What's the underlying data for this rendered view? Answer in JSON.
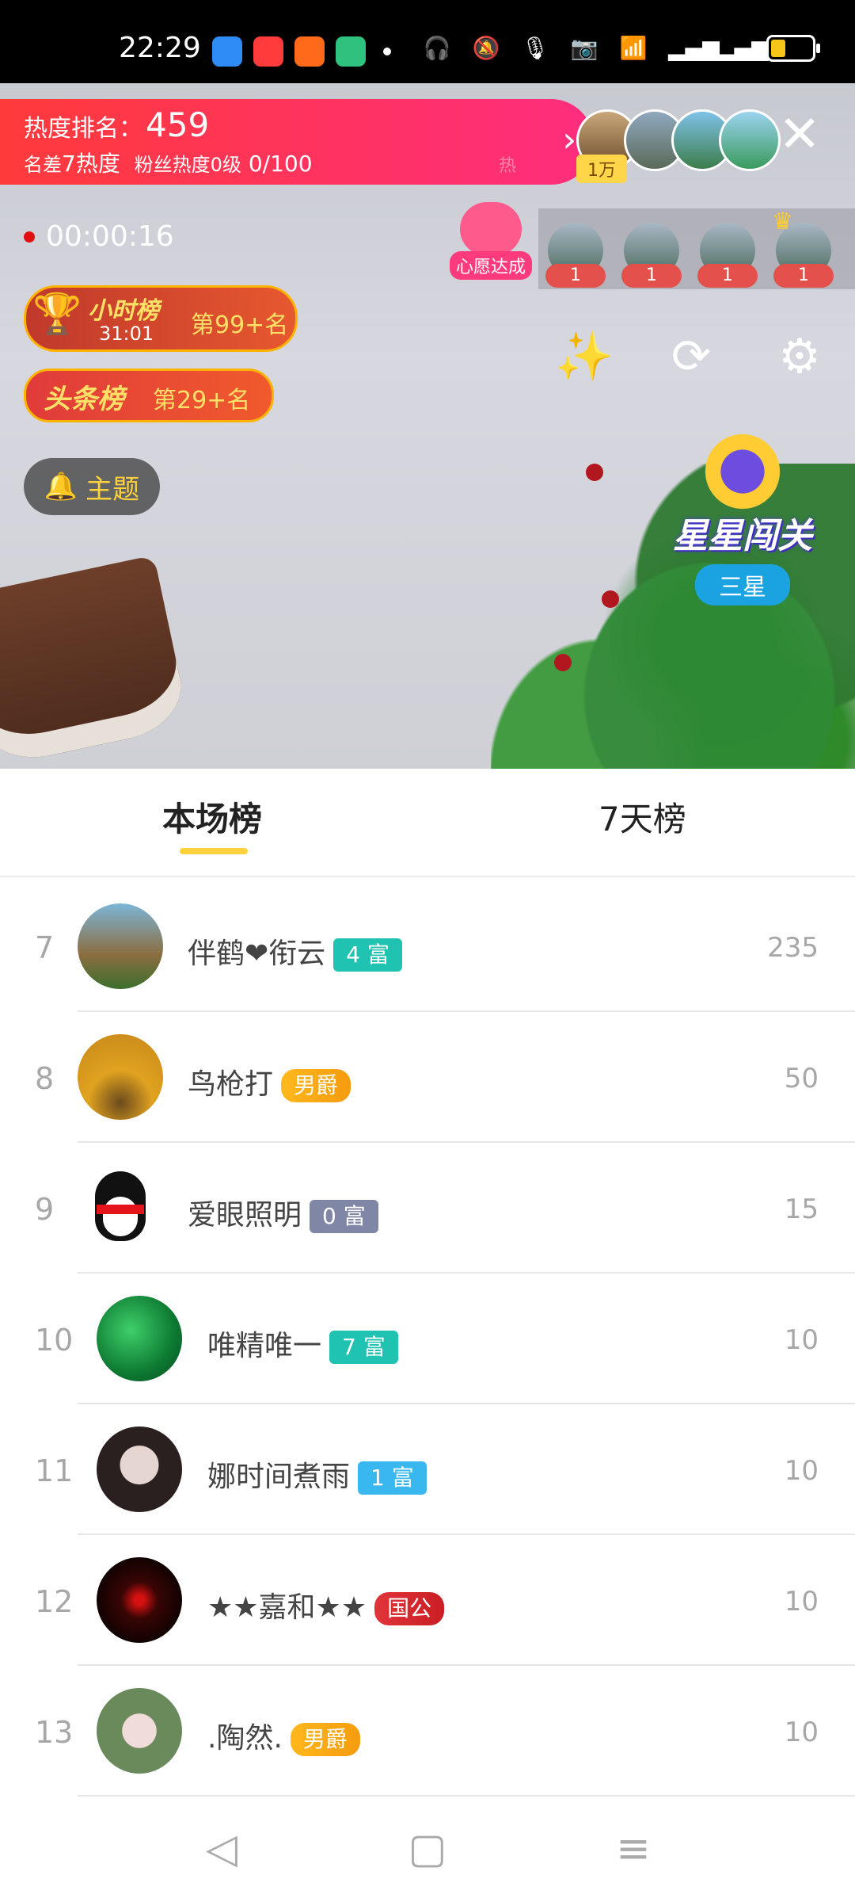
{
  "status_bar": {
    "time": "22:29"
  },
  "heat": {
    "rank_label": "热度排名：",
    "rank_value": "459",
    "line2_a": "名差",
    "line2_b": "7热度",
    "line2_c": "粉丝热度0级",
    "line2_d": "0/100",
    "faded": "热"
  },
  "top_viewers": {
    "badge": "1万"
  },
  "record_timer": "00:00:16",
  "wish": {
    "label": "心愿达成"
  },
  "guards": [
    {
      "count": "1"
    },
    {
      "count": "1"
    },
    {
      "count": "1"
    },
    {
      "count": "1"
    }
  ],
  "hour_rank": {
    "title": "小时榜",
    "countdown": "31:01",
    "position": "第99+名"
  },
  "headline_rank": {
    "title": "头条榜",
    "position": "第29+名"
  },
  "theme_button": {
    "label": "主题"
  },
  "level_badge": {
    "title": "星星闯关",
    "tier": "三星"
  },
  "tabs": [
    {
      "label": "本场榜",
      "active": true
    },
    {
      "label": "7天榜",
      "active": false
    }
  ],
  "leaderboard": [
    {
      "rank": "7",
      "name": "伴鹤❤衔云",
      "badge": "4 富",
      "badge_style": "teal",
      "score": "235"
    },
    {
      "rank": "8",
      "name": "鸟枪打",
      "badge": "男爵",
      "badge_style": "gold",
      "score": "50"
    },
    {
      "rank": "9",
      "name": "爱眼照明",
      "badge": "0 富",
      "badge_style": "gray",
      "score": "15"
    },
    {
      "rank": "10",
      "name": "唯精唯一",
      "badge": "7 富",
      "badge_style": "teal",
      "score": "10"
    },
    {
      "rank": "11",
      "name": "娜时间煮雨",
      "badge": "1 富",
      "badge_style": "blue",
      "score": "10"
    },
    {
      "rank": "12",
      "name": "★★嘉和★★",
      "badge": "国公",
      "badge_style": "red",
      "score": "10"
    },
    {
      "rank": "13",
      "name": ".陶然.",
      "badge": "男爵",
      "badge_style": "gold",
      "score": "10"
    }
  ]
}
